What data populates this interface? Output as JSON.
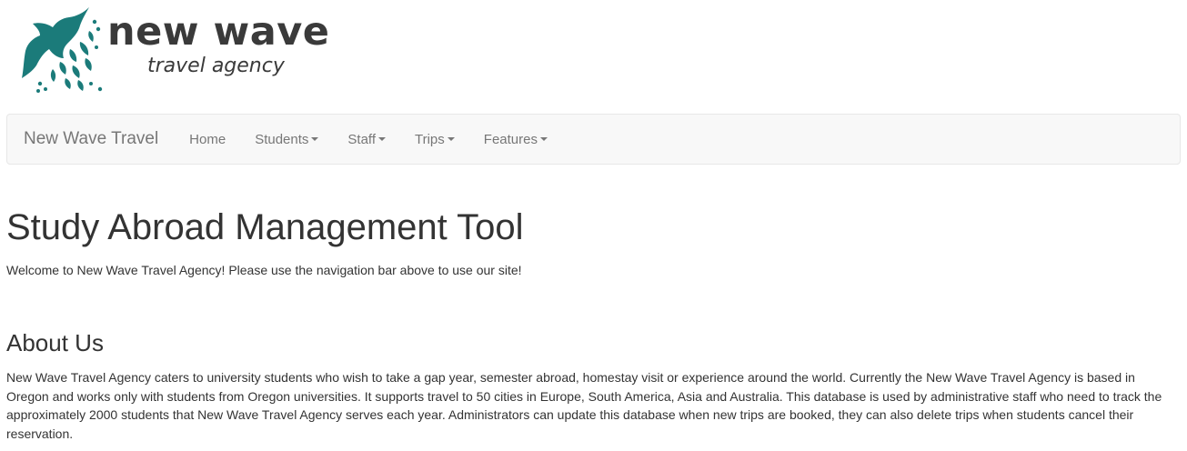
{
  "logo": {
    "title": "new wave",
    "subtitle": "travel agency",
    "icon": "bird-logo-icon",
    "brand_color": "#1b7b7a"
  },
  "navbar": {
    "brand": "New Wave Travel",
    "items": [
      {
        "label": "Home",
        "dropdown": false
      },
      {
        "label": "Students",
        "dropdown": true
      },
      {
        "label": "Staff",
        "dropdown": true
      },
      {
        "label": "Trips",
        "dropdown": true
      },
      {
        "label": "Features",
        "dropdown": true
      }
    ]
  },
  "main": {
    "title": "Study Abroad Management Tool",
    "welcome": "Welcome to New Wave Travel Agency! Please use the navigation bar above to use our site!",
    "about_heading": "About Us",
    "about_text": "New Wave Travel Agency caters to university students who wish to take a gap year, semester abroad, homestay visit or experience around the world. Currently the New Wave Travel Agency is based in Oregon and works only with students from Oregon universities. It supports travel to 50 cities in Europe, South America, Asia and Australia. This database is used by administrative staff who need to track the approximately 2000 students that New Wave Travel Agency serves each year. Administrators can update this database when new trips are booked, they can also delete trips when students cancel their reservation."
  }
}
